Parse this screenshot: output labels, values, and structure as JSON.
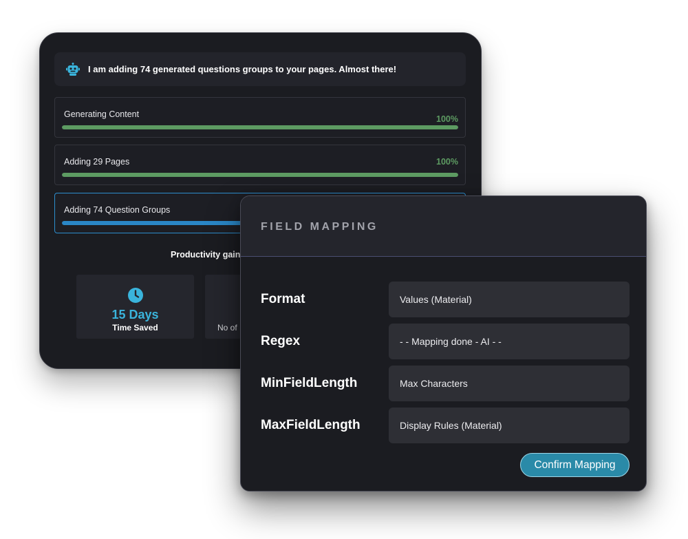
{
  "status_banner": {
    "icon": "robot-icon",
    "message": "I am adding 74 generated questions groups to your pages. Almost there!"
  },
  "progress": [
    {
      "label": "Generating Content",
      "percent_text": "100%",
      "value": 1.0,
      "state": "complete"
    },
    {
      "label": "Adding 29 Pages",
      "percent_text": "100%",
      "value": 1.0,
      "state": "complete"
    },
    {
      "label": "Adding 74 Question Groups",
      "percent_text": "",
      "value": 0.5,
      "state": "in-progress"
    }
  ],
  "productivity": {
    "title": "Productivity gains",
    "stats": [
      {
        "icon": "clock-icon",
        "value": "15 Days",
        "label": "Time Saved"
      },
      {
        "icon": "",
        "value": "",
        "label": "No of"
      }
    ]
  },
  "field_mapping": {
    "title": "FIELD MAPPING",
    "rows": [
      {
        "field": "Format",
        "value": "Values (Material)"
      },
      {
        "field": "Regex",
        "value": "- - Mapping done - AI - -"
      },
      {
        "field": "MinFieldLength",
        "value": "Max Characters"
      },
      {
        "field": "MaxFieldLength",
        "value": "Display Rules (Material)"
      }
    ],
    "confirm_label": "Confirm Mapping"
  },
  "colors": {
    "window_bg": "#1b1c21",
    "complete": "#5d9b62",
    "in_progress": "#2a87c7",
    "accent_value": "#3ab4dc",
    "confirm_button": "#2a8aa8"
  }
}
